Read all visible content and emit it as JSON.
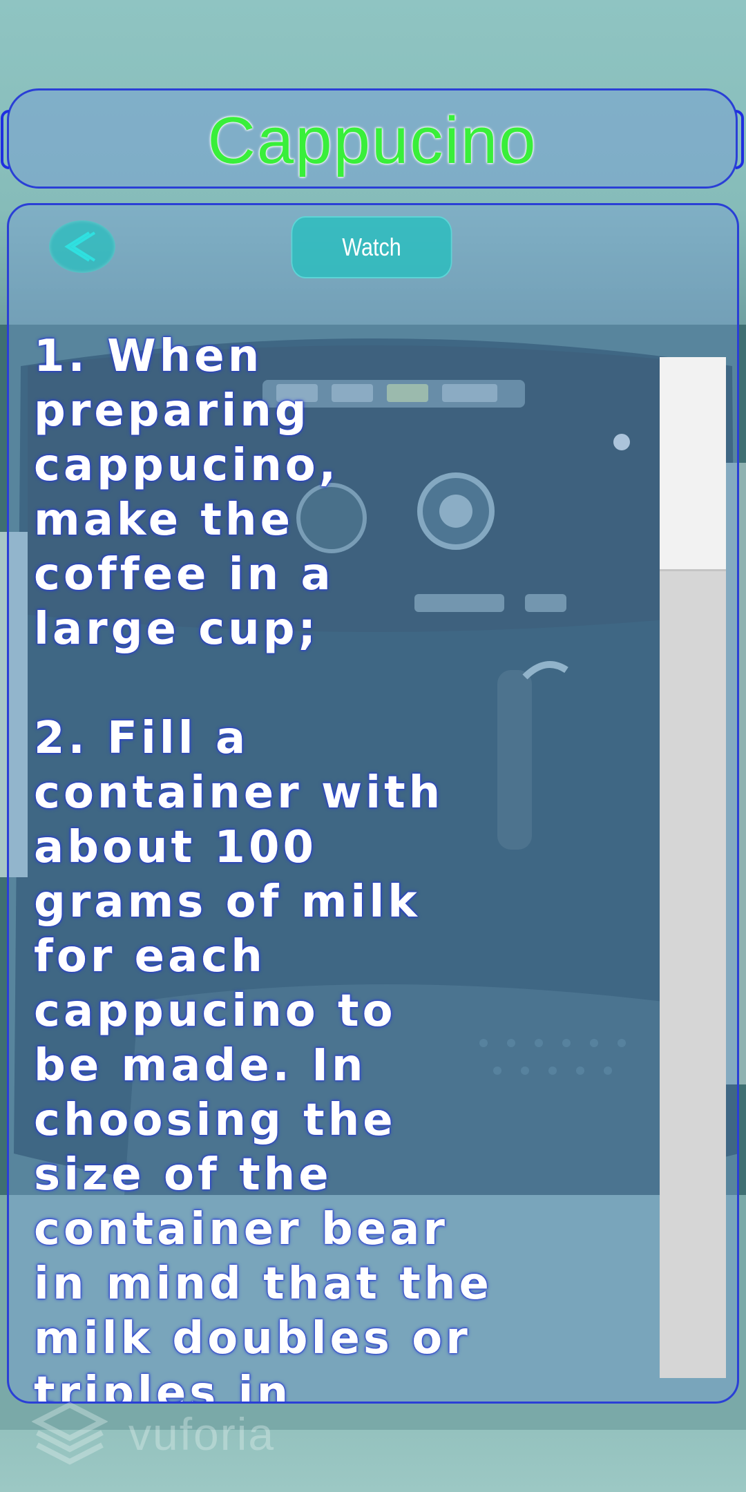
{
  "header": {
    "title": "Cappucino"
  },
  "toolbar": {
    "back_icon": "chevron-left-icon",
    "watch_label": "Watch"
  },
  "recipe": {
    "instructions": "1. When\npreparing\ncappucino,\nmake the\ncoffee in a\nlarge cup;\n\n2. Fill a\ncontainer with\nabout 100\ngrams of milk\nfor each\ncappucino to\nbe made. In\nchoosing the\nsize of the\ncontainer bear\nin mind that the\nmilk doubles or\ntriples in"
  },
  "scrollbar": {
    "position_fraction": 0.0,
    "visible_fraction": 0.21
  },
  "watermark": {
    "brand": "vuforia"
  },
  "colors": {
    "title": "#39ef3a",
    "panel_border": "#2a3fd6",
    "button": "#28bebe",
    "text": "#ffffff"
  }
}
